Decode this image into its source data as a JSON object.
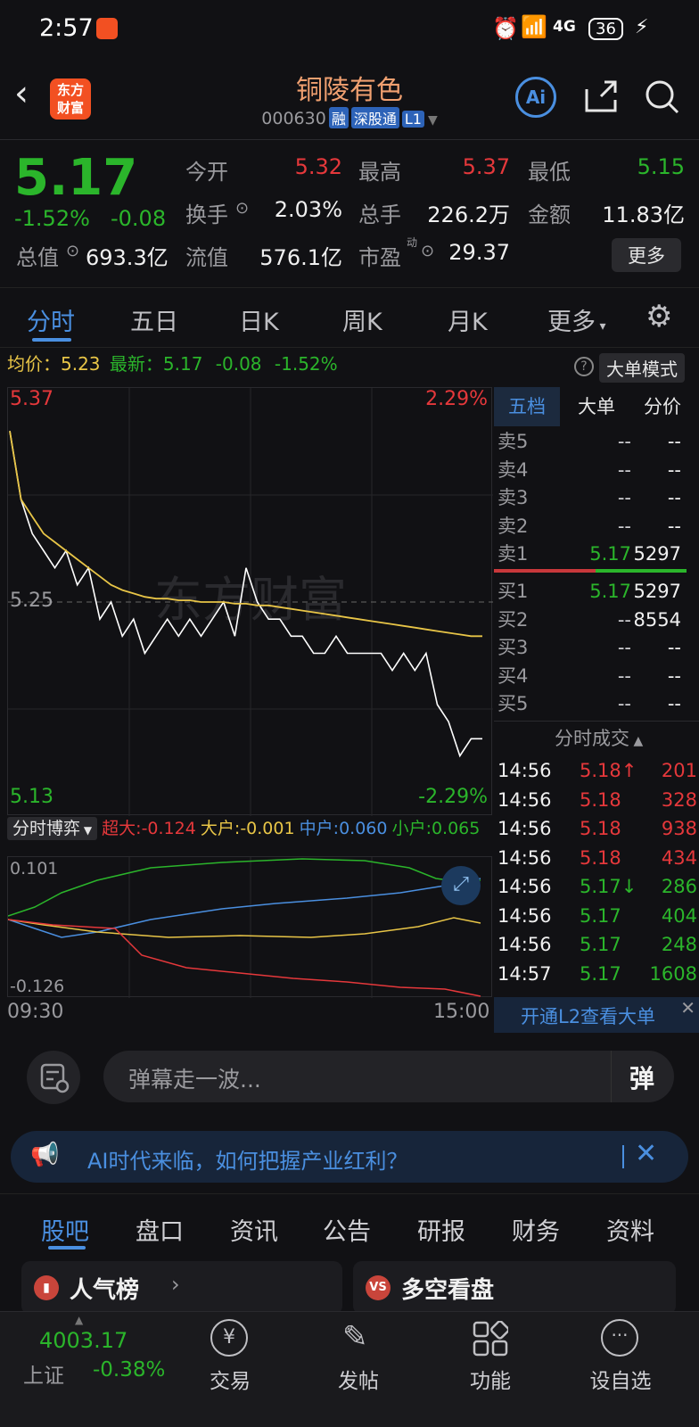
{
  "status_bar": {
    "time": "2:57",
    "network": "4G",
    "battery": "36"
  },
  "header": {
    "logo_text_1": "东方",
    "logo_text_2": "财富",
    "title": "铜陵有色",
    "code": "000630",
    "tags": [
      "融",
      "深股通",
      "L1"
    ]
  },
  "quote": {
    "price": "5.17",
    "change_pct": "-1.52%",
    "change": "-0.08",
    "open_label": "今开",
    "open": "5.32",
    "high_label": "最高",
    "high": "5.37",
    "low_label": "最低",
    "low": "5.15",
    "turnover_label": "换手",
    "turnover": "2.03%",
    "volume_label": "总手",
    "volume": "226.2万",
    "amount_label": "金额",
    "amount": "11.83亿",
    "mktcap_label": "总值",
    "mktcap": "693.3亿",
    "float_label": "流值",
    "float": "576.1亿",
    "pe_label": "市盈",
    "pe_sup": "动",
    "pe": "29.37",
    "more": "更多"
  },
  "tabs": [
    "分时",
    "五日",
    "日K",
    "周K",
    "月K",
    "更多"
  ],
  "avg_line": {
    "avg_label": "均价：",
    "avg": "5.23",
    "latest_label": "最新：",
    "latest": "5.17",
    "chg": "-0.08",
    "pct": "-1.52%",
    "big_order_mode": "大单模式"
  },
  "chart": {
    "y_top": "5.37",
    "y_mid": "5.25",
    "y_bottom": "5.13",
    "pct_top": "2.29%",
    "pct_bottom": "-2.29%",
    "watermark": "东方财富",
    "time_start": "09:30",
    "time_end": "15:00"
  },
  "chart_data": {
    "type": "line",
    "title": "",
    "xlabel": "",
    "ylabel": "",
    "ylim": [
      5.13,
      5.37
    ],
    "series": [
      {
        "name": "",
        "color": "#ffffff",
        "values": [
          5.35,
          5.31,
          5.29,
          5.28,
          5.27,
          5.28,
          5.26,
          5.27,
          5.24,
          5.25,
          5.23,
          5.24,
          5.22,
          5.23,
          5.24,
          5.23,
          5.24,
          5.23,
          5.24,
          5.25,
          5.23,
          5.27,
          5.25,
          5.24,
          5.24,
          5.23,
          5.23,
          5.22,
          5.22,
          5.23,
          5.22,
          5.22,
          5.22,
          5.22,
          5.21,
          5.22,
          5.21,
          5.22,
          5.19,
          5.18,
          5.16,
          5.17,
          5.17
        ]
      },
      {
        "name": "均价",
        "color": "#e8c547",
        "values": [
          5.35,
          5.31,
          5.3,
          5.29,
          5.285,
          5.28,
          5.275,
          5.27,
          5.265,
          5.26,
          5.257,
          5.255,
          5.253,
          5.252,
          5.252,
          5.251,
          5.251,
          5.25,
          5.25,
          5.25,
          5.249,
          5.249,
          5.248,
          5.248,
          5.247,
          5.246,
          5.245,
          5.244,
          5.243,
          5.242,
          5.241,
          5.24,
          5.239,
          5.238,
          5.237,
          5.236,
          5.235,
          5.234,
          5.233,
          5.232,
          5.231,
          5.23,
          5.23
        ]
      }
    ]
  },
  "order_book": {
    "tabs": [
      "五档",
      "大单",
      "分价"
    ],
    "sell": [
      {
        "label": "卖5",
        "price": "--",
        "vol": "--"
      },
      {
        "label": "卖4",
        "price": "--",
        "vol": "--"
      },
      {
        "label": "卖3",
        "price": "--",
        "vol": "--"
      },
      {
        "label": "卖2",
        "price": "--",
        "vol": "--"
      },
      {
        "label": "卖1",
        "price": "5.17",
        "vol": "5297"
      }
    ],
    "buy": [
      {
        "label": "买1",
        "price": "5.17",
        "vol": "5297"
      },
      {
        "label": "买2",
        "price": "--",
        "vol": "8554"
      },
      {
        "label": "买3",
        "price": "--",
        "vol": "--"
      },
      {
        "label": "买4",
        "price": "--",
        "vol": "--"
      },
      {
        "label": "买5",
        "price": "--",
        "vol": "--"
      }
    ],
    "trades_title": "分时成交",
    "trades": [
      {
        "time": "14:56",
        "price": "5.18",
        "dir": "↑",
        "vol": "201",
        "color": "#e5383b"
      },
      {
        "time": "14:56",
        "price": "5.18",
        "dir": "",
        "vol": "328",
        "color": "#e5383b"
      },
      {
        "time": "14:56",
        "price": "5.18",
        "dir": "",
        "vol": "938",
        "color": "#e5383b"
      },
      {
        "time": "14:56",
        "price": "5.18",
        "dir": "",
        "vol": "434",
        "color": "#e5383b"
      },
      {
        "time": "14:56",
        "price": "5.17",
        "dir": "↓",
        "vol": "286",
        "color": "#2bb52b"
      },
      {
        "time": "14:56",
        "price": "5.17",
        "dir": "",
        "vol": "404",
        "color": "#2bb52b"
      },
      {
        "time": "14:56",
        "price": "5.17",
        "dir": "",
        "vol": "248",
        "color": "#2bb52b"
      },
      {
        "time": "14:57",
        "price": "5.17",
        "dir": "",
        "vol": "1608",
        "color": "#2bb52b"
      }
    ],
    "l2_link": "开通L2查看大单"
  },
  "sub_chart": {
    "selector": "分时博弈",
    "super_label": "超大:",
    "super": "-0.124",
    "large_label": "大户:",
    "large": "-0.001",
    "mid_label": "中户:",
    "mid": "0.060",
    "small_label": "小户:",
    "small": "0.065",
    "y_top": "0.101",
    "y_bottom": "-0.126"
  },
  "comment": {
    "placeholder": "弹幕走一波...",
    "danmu": "弹"
  },
  "banner": {
    "text": "AI时代来临，如何把握产业红利？"
  },
  "feature_tabs": [
    "股吧",
    "盘口",
    "资讯",
    "公告",
    "研报",
    "财务",
    "资料"
  ],
  "cards": {
    "left": "人气榜",
    "right": "多空看盘"
  },
  "bottom_nav": {
    "index_value": "4003.17",
    "index_name": "上证",
    "index_pct": "-0.38%",
    "items": [
      "交易",
      "发帖",
      "功能",
      "设自选"
    ]
  }
}
